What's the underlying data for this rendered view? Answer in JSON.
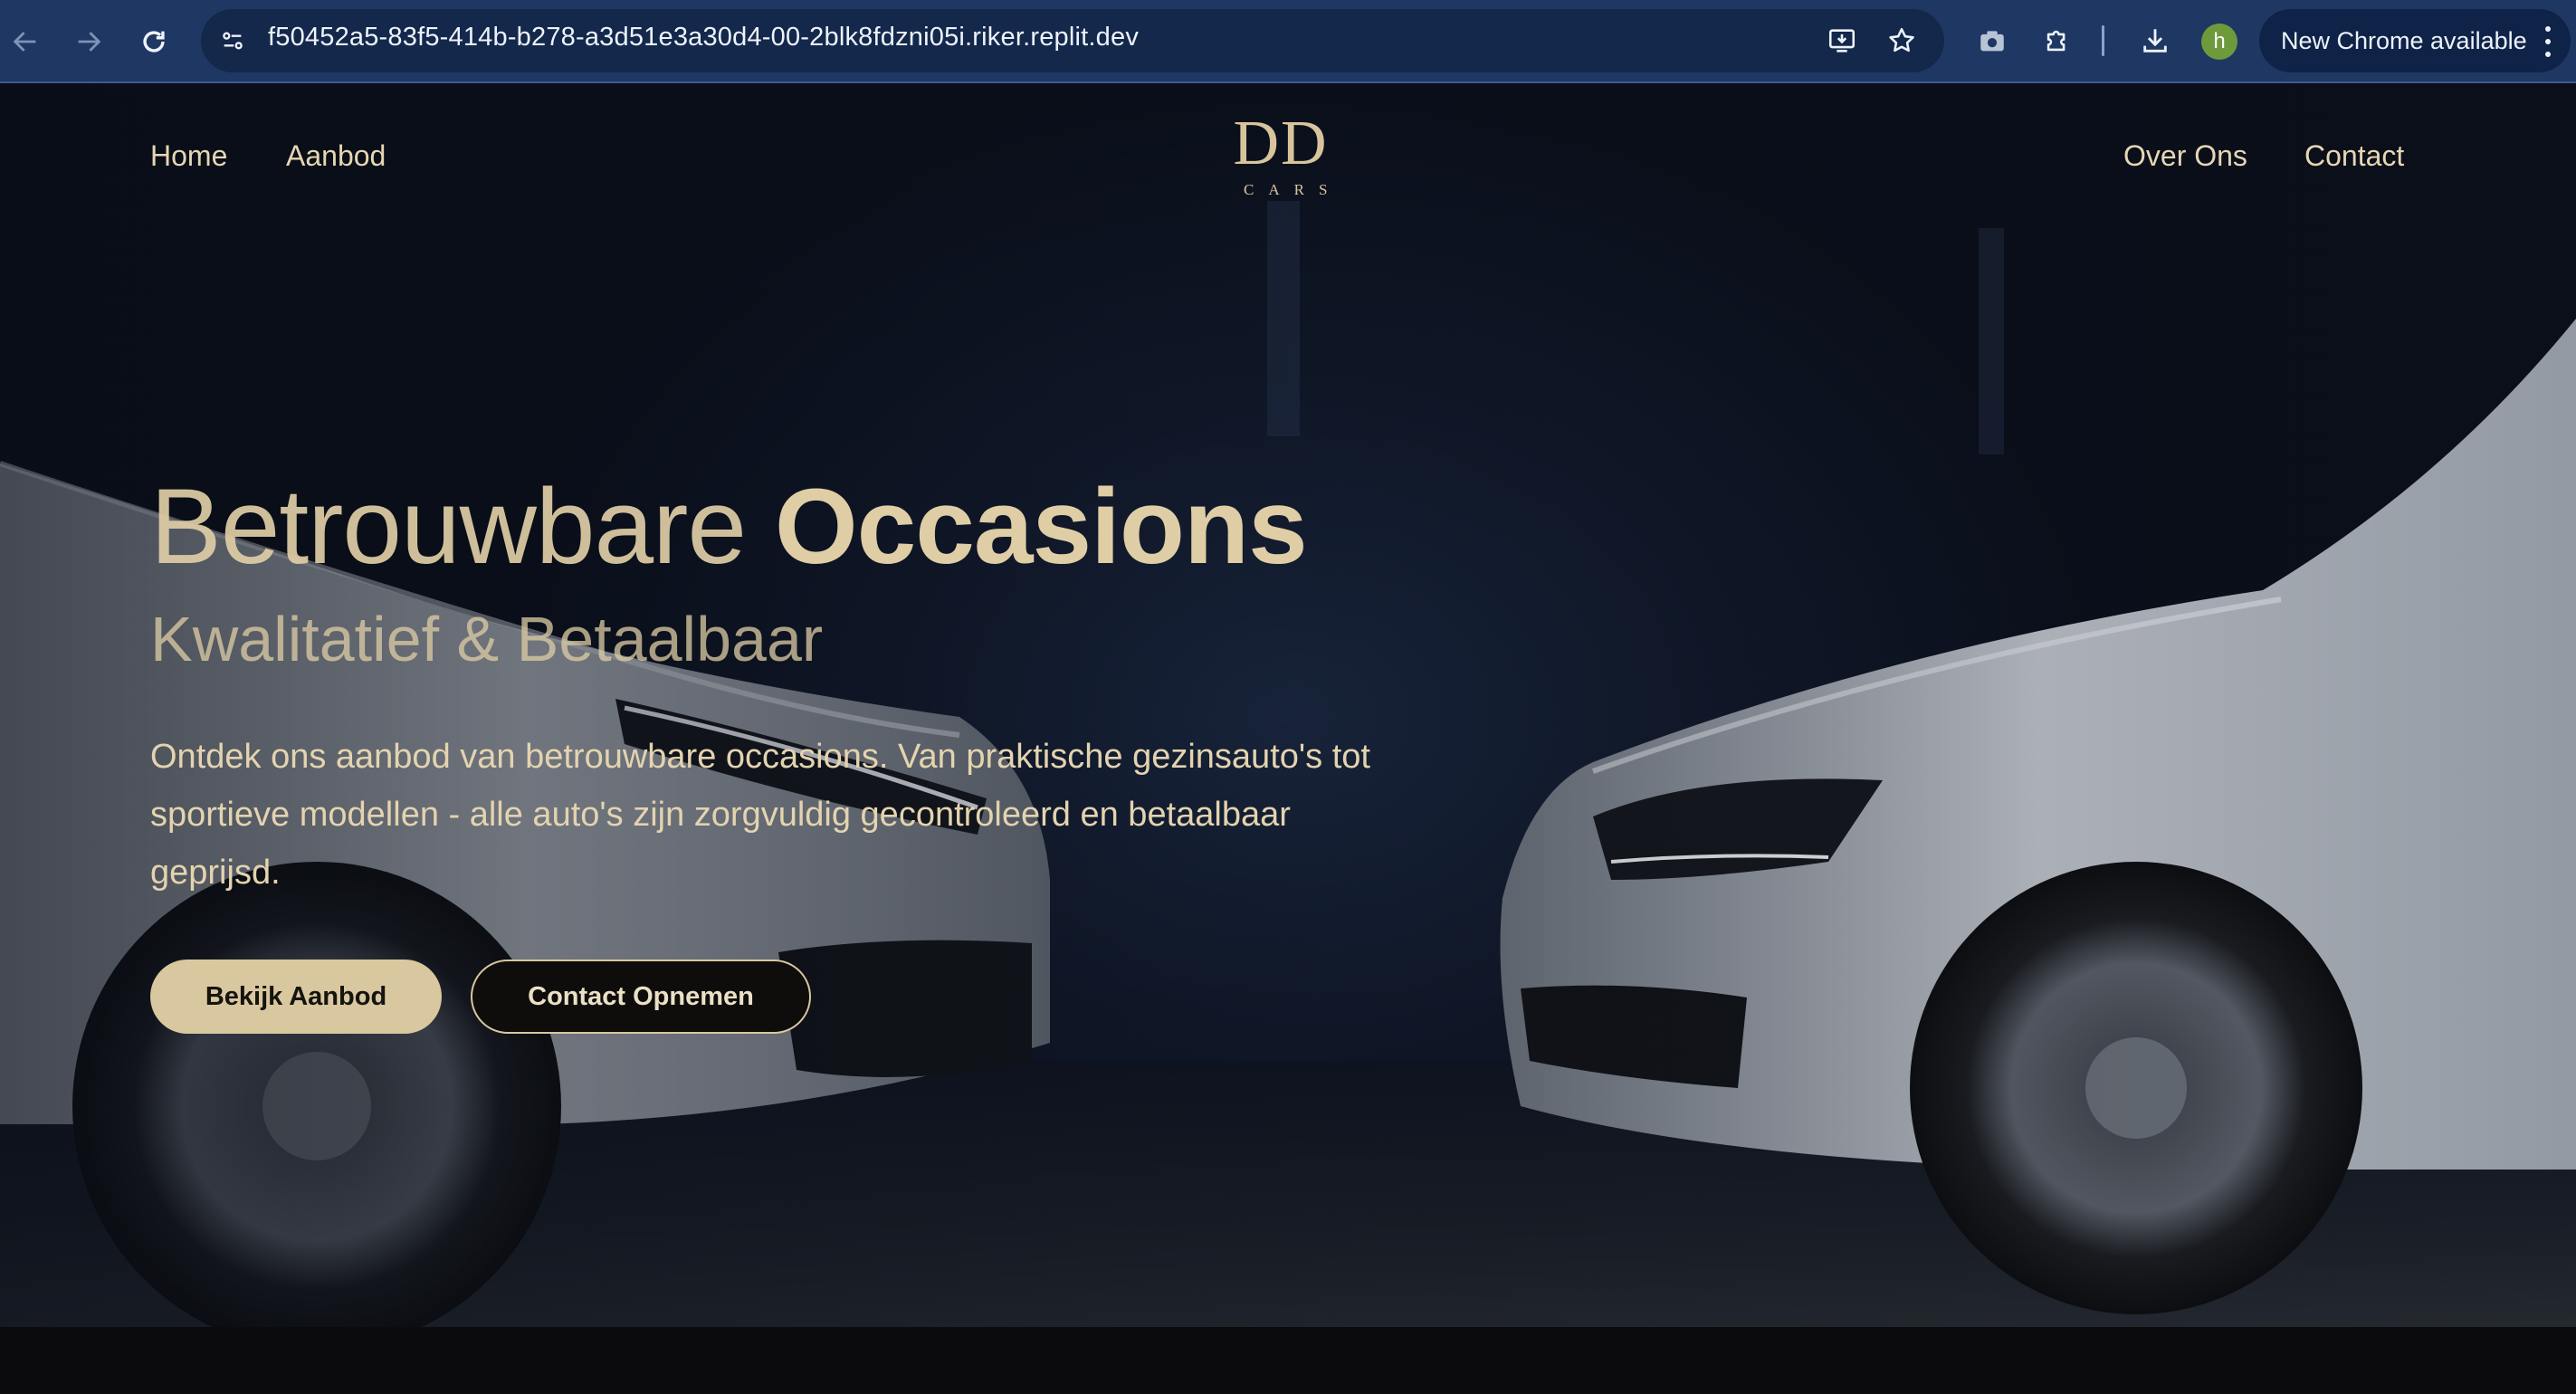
{
  "browser": {
    "url": "f50452a5-83f5-414b-b278-a3d51e3a30d4-00-2blk8fdzni05i.riker.replit.dev",
    "profile_initial": "h",
    "update_label": "New Chrome available",
    "icons": [
      "back-icon",
      "forward-icon",
      "reload-icon",
      "site-info-icon",
      "install-app-icon",
      "bookmark-star-icon",
      "screenshot-camera-icon",
      "extensions-puzzle-icon",
      "download-icon",
      "menu-kebab-icon"
    ]
  },
  "site": {
    "nav": {
      "left": [
        "Home",
        "Aanbod"
      ],
      "right": [
        "Over Ons",
        "Contact"
      ]
    },
    "logo": {
      "main": "DD",
      "sub": "CARS"
    },
    "hero": {
      "title_light": "Betrouwbare",
      "title_bold": "Occasions",
      "subtitle": "Kwalitatief & Betaalbaar",
      "lead": "Ontdek ons aanbod van betrouwbare occasions. Van praktische gezinsauto's tot sportieve modellen - alle auto's zijn zorgvuldig gecontroleerd en betaalbaar geprijsd.",
      "primary_button": "Bekijk Aanbod",
      "secondary_button": "Contact Opnemen"
    },
    "colors": {
      "gold": "#d9c7a0",
      "background": "#0b0b0d",
      "chrome_bar": "#1f3763"
    }
  }
}
